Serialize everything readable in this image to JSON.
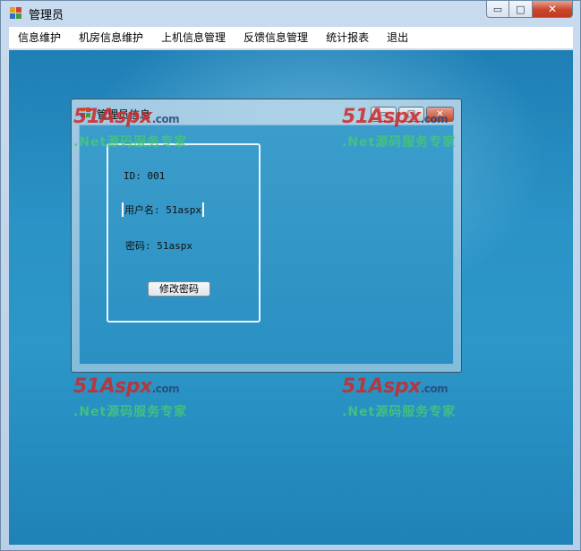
{
  "window": {
    "title": "管理员",
    "controls": {
      "minimize_glyph": "▭",
      "maximize_glyph": "□",
      "close_glyph": "✕"
    }
  },
  "menu": {
    "items": [
      {
        "label": "信息维护"
      },
      {
        "label": "机房信息维护"
      },
      {
        "label": "上机信息管理"
      },
      {
        "label": "反馈信息管理"
      },
      {
        "label": "统计报表"
      },
      {
        "label": "退出"
      }
    ]
  },
  "child_window": {
    "title": "管理员信息",
    "controls": {
      "minimize_glyph": "▭",
      "maximize_glyph": "□",
      "close_glyph": "✕"
    },
    "fields": {
      "id_label": "ID: 001",
      "username_label": "用户名: 51aspx",
      "password_label": "密码: 51aspx"
    },
    "change_password_button": "修改密码"
  },
  "watermark": {
    "brand_main": "51Aspx",
    "brand_suffix": ".com",
    "tagline": ".Net源码服务专家"
  },
  "colors": {
    "desktop_blue": "#2b93c6",
    "close_red": "#c9462a",
    "watermark_red": "#cd2828",
    "watermark_green": "#46c878"
  },
  "icons": [
    "app-icon",
    "minimize-icon",
    "maximize-icon",
    "close-icon"
  ]
}
